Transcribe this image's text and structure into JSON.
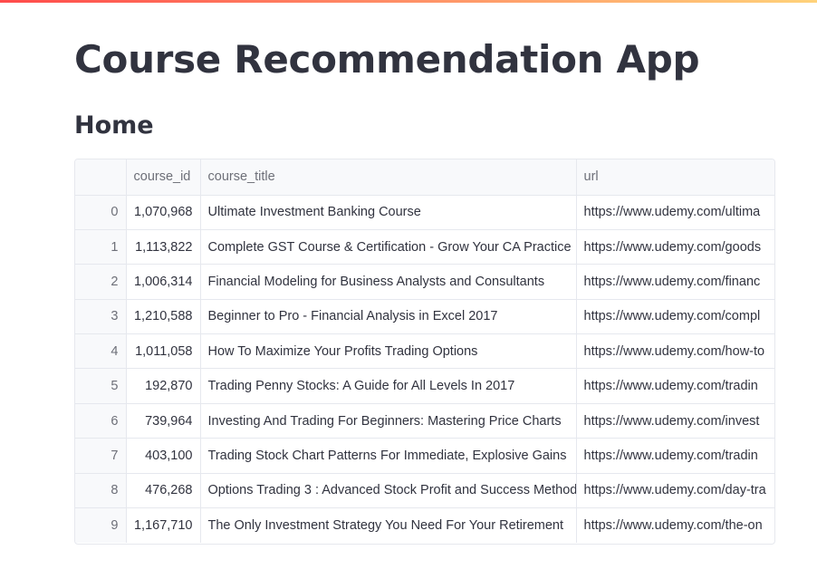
{
  "app": {
    "title": "Course Recommendation App",
    "section": "Home"
  },
  "table": {
    "columns": [
      "",
      "course_id",
      "course_title",
      "url"
    ],
    "rows": [
      {
        "index": "0",
        "course_id": "1,070,968",
        "course_title": "Ultimate Investment Banking Course",
        "url": "https://www.udemy.com/ultima"
      },
      {
        "index": "1",
        "course_id": "1,113,822",
        "course_title": "Complete GST Course & Certification - Grow Your CA Practice",
        "url": "https://www.udemy.com/goods"
      },
      {
        "index": "2",
        "course_id": "1,006,314",
        "course_title": "Financial Modeling for Business Analysts and Consultants",
        "url": "https://www.udemy.com/financ"
      },
      {
        "index": "3",
        "course_id": "1,210,588",
        "course_title": "Beginner to Pro - Financial Analysis in Excel 2017",
        "url": "https://www.udemy.com/compl"
      },
      {
        "index": "4",
        "course_id": "1,011,058",
        "course_title": "How To Maximize Your Profits Trading Options",
        "url": "https://www.udemy.com/how-to"
      },
      {
        "index": "5",
        "course_id": "192,870",
        "course_title": "Trading Penny Stocks: A Guide for All Levels In 2017",
        "url": "https://www.udemy.com/tradin"
      },
      {
        "index": "6",
        "course_id": "739,964",
        "course_title": "Investing And Trading For Beginners: Mastering Price Charts",
        "url": "https://www.udemy.com/invest"
      },
      {
        "index": "7",
        "course_id": "403,100",
        "course_title": "Trading Stock Chart Patterns For Immediate, Explosive Gains",
        "url": "https://www.udemy.com/tradin"
      },
      {
        "index": "8",
        "course_id": "476,268",
        "course_title": "Options Trading 3 : Advanced Stock Profit and Success Method",
        "url": "https://www.udemy.com/day-tra"
      },
      {
        "index": "9",
        "course_id": "1,167,710",
        "course_title": "The Only Investment Strategy You Need For Your Retirement",
        "url": "https://www.udemy.com/the-on"
      }
    ]
  }
}
